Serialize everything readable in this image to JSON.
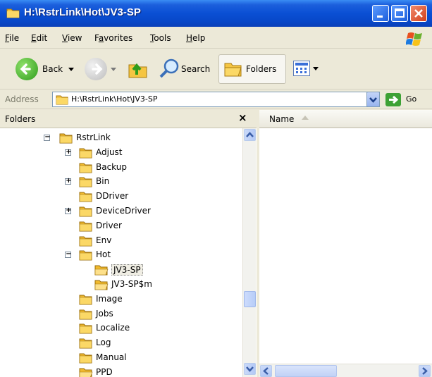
{
  "window": {
    "title": "H:\\RstrLink\\Hot\\JV3-SP"
  },
  "menu": {
    "items": [
      {
        "pre": "",
        "u": "F",
        "post": "ile"
      },
      {
        "pre": "",
        "u": "E",
        "post": "dit"
      },
      {
        "pre": "",
        "u": "V",
        "post": "iew"
      },
      {
        "pre": "F",
        "u": "a",
        "post": "vorites"
      },
      {
        "pre": "",
        "u": "T",
        "post": "ools"
      },
      {
        "pre": "",
        "u": "H",
        "post": "elp"
      }
    ]
  },
  "toolbar": {
    "back_label": "Back",
    "search_label": "Search",
    "folders_label": "Folders"
  },
  "address": {
    "label": "Address",
    "value": "H:\\RstrLink\\Hot\\JV3-SP",
    "go_label": "Go"
  },
  "folders_pane": {
    "title": "Folders",
    "close_glyph": "×"
  },
  "tree": {
    "items": [
      {
        "label": "RstrLink",
        "expander": "minus",
        "level": 0,
        "open_icon": false
      },
      {
        "label": "Adjust",
        "expander": "plus",
        "level": 1,
        "open_icon": false
      },
      {
        "label": "Backup",
        "expander": "none",
        "level": 1,
        "open_icon": false
      },
      {
        "label": "Bin",
        "expander": "plus",
        "level": 1,
        "open_icon": false
      },
      {
        "label": "DDriver",
        "expander": "none",
        "level": 1,
        "open_icon": false
      },
      {
        "label": "DeviceDriver",
        "expander": "plus",
        "level": 1,
        "open_icon": false
      },
      {
        "label": "Driver",
        "expander": "none",
        "level": 1,
        "open_icon": false
      },
      {
        "label": "Env",
        "expander": "none",
        "level": 1,
        "open_icon": false
      },
      {
        "label": "Hot",
        "expander": "minus",
        "level": 1,
        "open_icon": false
      },
      {
        "label": "JV3-SP",
        "expander": "none",
        "level": 2,
        "open_icon": true,
        "selected": true
      },
      {
        "label": "JV3-SP$m",
        "expander": "none",
        "level": 2,
        "open_icon": true
      },
      {
        "label": "Image",
        "expander": "none",
        "level": 1,
        "open_icon": false
      },
      {
        "label": "Jobs",
        "expander": "none",
        "level": 1,
        "open_icon": false
      },
      {
        "label": "Localize",
        "expander": "none",
        "level": 1,
        "open_icon": false
      },
      {
        "label": "Log",
        "expander": "none",
        "level": 1,
        "open_icon": false
      },
      {
        "label": "Manual",
        "expander": "none",
        "level": 1,
        "open_icon": false
      },
      {
        "label": "PPD",
        "expander": "none",
        "level": 1,
        "open_icon": true
      }
    ]
  },
  "list": {
    "column_name": "Name"
  },
  "colors": {
    "titlebar": "#0a4fd4",
    "folder": "#f5c542",
    "selection_text": "#000000"
  }
}
